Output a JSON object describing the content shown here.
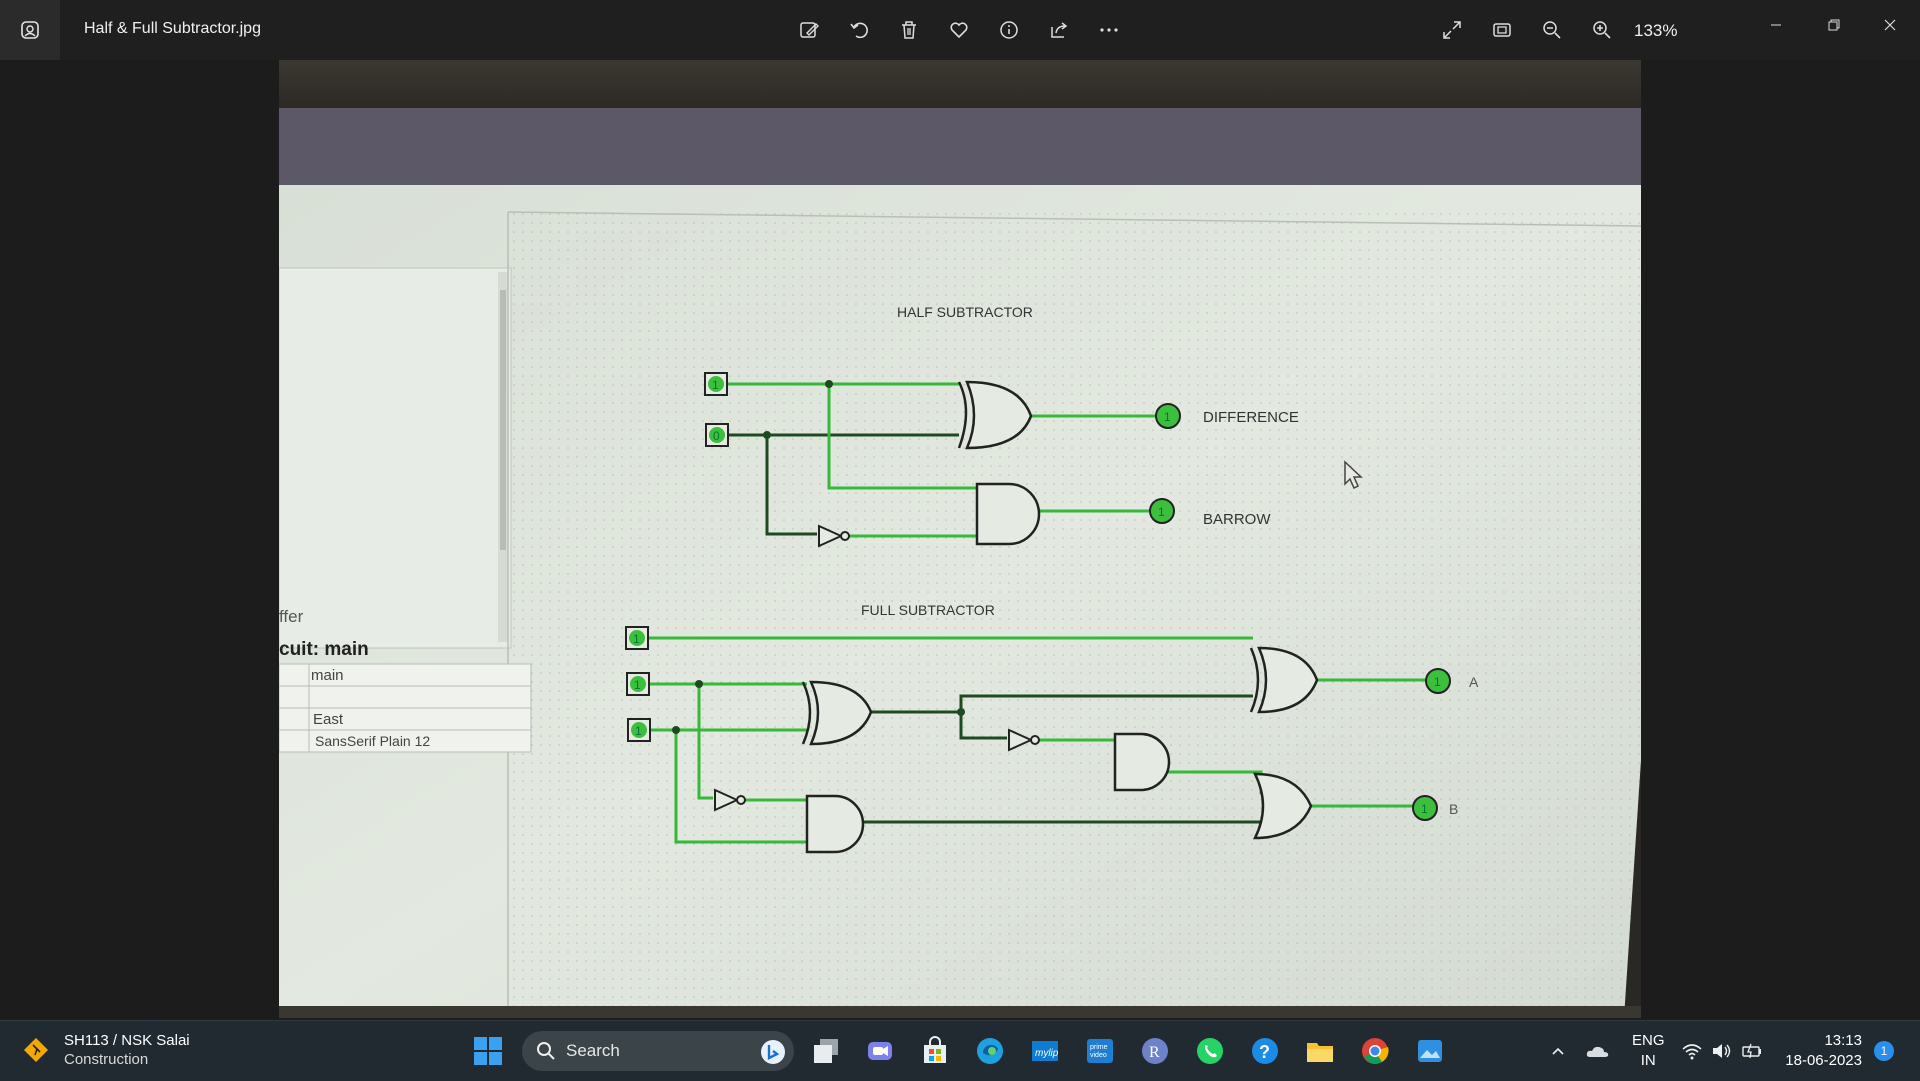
{
  "titlebar": {
    "file_name": "Half & Full Subtractor.jpg",
    "zoom": "133%",
    "toolbar_icons": [
      "edit-icon",
      "rotate-icon",
      "delete-icon",
      "favorite-icon",
      "info-icon",
      "share-icon",
      "more-icon"
    ],
    "view_icons": [
      "fullscreen-icon",
      "fit-icon",
      "zoom-out-icon",
      "zoom-in-icon"
    ]
  },
  "photo": {
    "half_title": "HALF SUBTRACTOR",
    "full_title": "FULL SUBTRACTOR",
    "out_difference": "DIFFERENCE",
    "out_barrow": "BARROW",
    "out_a": "A",
    "out_b": "B",
    "half_inputs": [
      "1",
      "0"
    ],
    "half_outputs": [
      "1",
      "1"
    ],
    "full_inputs": [
      "1",
      "1",
      "1"
    ],
    "full_outputs": [
      "1",
      "1"
    ],
    "side_panel": {
      "fragment": "ffer",
      "circuit_label": "cuit: main",
      "rows": [
        "main",
        "",
        "East",
        "SansSerif Plain 12"
      ]
    }
  },
  "taskbar": {
    "weather_title": "SH113 / NSK Salai",
    "weather_sub": "Construction",
    "search_placeholder": "Search",
    "lang_top": "ENG",
    "lang_bottom": "IN",
    "time": "13:13",
    "date": "18-06-2023",
    "notification_count": "1"
  },
  "colors": {
    "wire_green": "#36b83a",
    "wire_dark": "#1e4a22",
    "canvas": "#dfe6dc",
    "accent": "#2a8df0"
  }
}
